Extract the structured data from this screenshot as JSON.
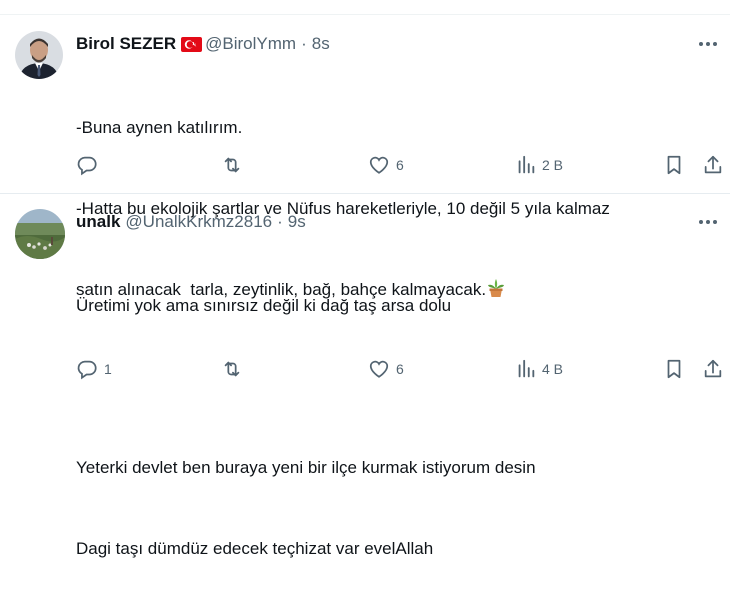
{
  "tweets": [
    {
      "author_name": "Birol SEZER",
      "handle": "@BirolYmm",
      "separator": "·",
      "time": "8s",
      "line1": "-Buna aynen katılırım.",
      "line2": "-Hatta bu ekolojik şartlar ve Nüfus hareketleriyle, 10 değil 5 yıla kalmaz",
      "line3": "satın alınacak  tarla, zeytinlik, bağ, bahçe kalmayacak.",
      "reply_count": "",
      "retweet_count": "",
      "like_count": "6",
      "view_count": "2 B",
      "icons": [
        "turkey-flag-icon",
        "more-icon",
        "reply-icon",
        "retweet-icon",
        "like-icon",
        "views-icon",
        "bookmark-icon",
        "share-icon",
        "potted-plant-icon"
      ]
    },
    {
      "author_name": "unalk",
      "handle": "@UnalkKrkmz2816",
      "separator": "·",
      "time": "9s",
      "line1": "Üretimi yok ama sınırsız değil ki dağ taş arsa dolu",
      "line2": "Yeterki devlet ben buraya yeni bir ilçe kurmak istiyorum desin",
      "line3": "Dagi taşı dümdüz edecek teçhizat var evelAllah",
      "reply_count": "1",
      "retweet_count": "",
      "like_count": "6",
      "view_count": "4 B",
      "icons": [
        "more-icon",
        "reply-icon",
        "retweet-icon",
        "like-icon",
        "views-icon",
        "bookmark-icon",
        "share-icon"
      ]
    }
  ],
  "colors": {
    "text": "#0f1419",
    "secondary": "#536471",
    "divider": "#eff3f4",
    "flag_red": "#e30a17"
  }
}
